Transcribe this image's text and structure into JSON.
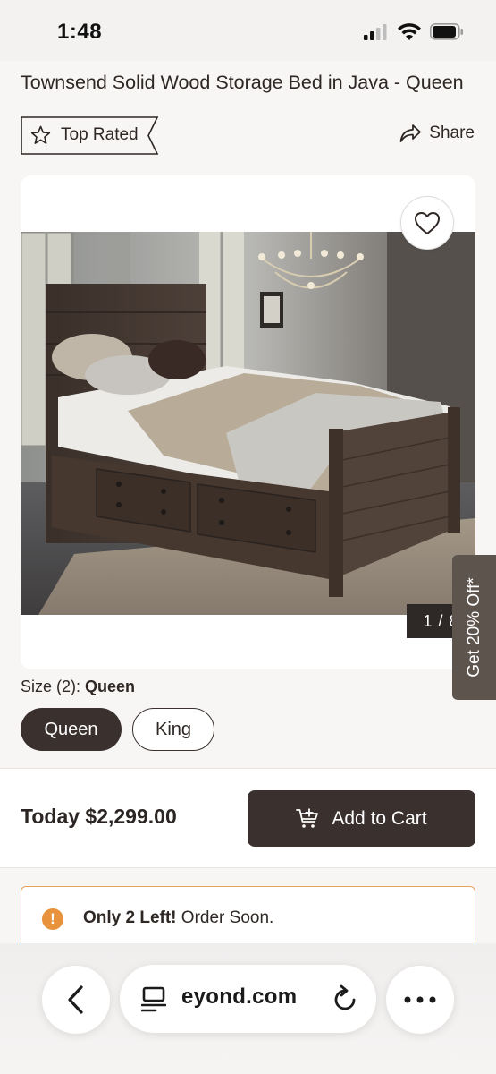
{
  "status": {
    "time": "1:48"
  },
  "product": {
    "title": "Townsend Solid Wood Storage Bed in Java - Queen",
    "badge": "Top Rated",
    "share_label": "Share"
  },
  "gallery": {
    "counter": "1 / 8"
  },
  "promo": {
    "label": "Get 20% Off*"
  },
  "size": {
    "label_prefix": "Size (2): ",
    "selected": "Queen",
    "options": [
      "Queen",
      "King"
    ]
  },
  "purchase": {
    "price": "Today $2,299.00",
    "add_to_cart": "Add to Cart"
  },
  "stock": {
    "strong": "Only 2 Left!",
    "rest": " Order Soon."
  },
  "browser": {
    "url": "eyond.com"
  },
  "colors": {
    "primary_dark": "#3a302e",
    "promo_tab": "#5e544e",
    "stock_accent": "#e8923b"
  },
  "icons": [
    "signal-icon",
    "wifi-icon",
    "battery-icon",
    "star-icon",
    "share-icon",
    "heart-icon",
    "cart-plus-icon",
    "alert-icon",
    "back-icon",
    "tabs-icon",
    "reload-icon",
    "more-icon"
  ]
}
